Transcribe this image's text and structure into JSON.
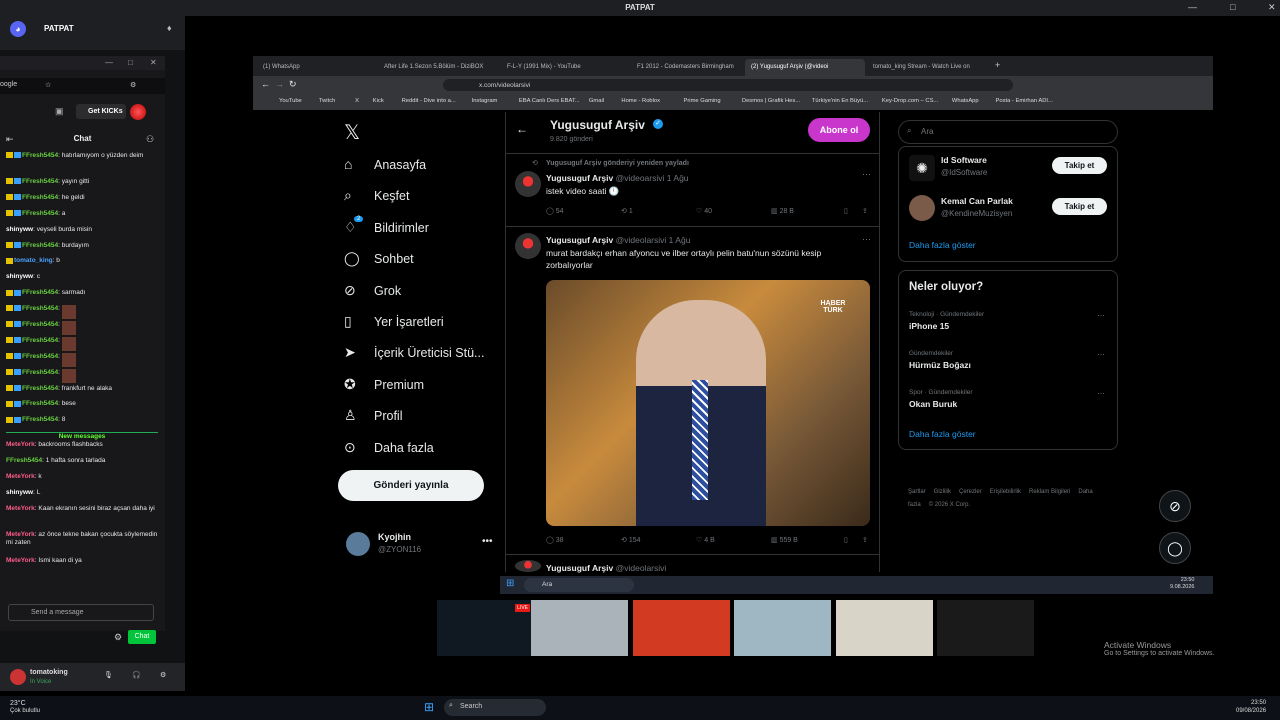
{
  "os": {
    "title": "PATPAT"
  },
  "discord": {
    "server": "PATPAT",
    "user": {
      "name": "tomatoking",
      "status": "In Voice"
    },
    "weather": {
      "temp": "23°C",
      "desc": "Çok bulutlu"
    }
  },
  "kick": {
    "search_label": "oogle",
    "get_kicks": "Get KICKs",
    "chat_title": "Chat",
    "input_placeholder": "Send a message",
    "send_label": "Chat",
    "new_messages": "New messages",
    "messages": [
      {
        "user": "FFresh5454",
        "text": "hatırlamıyom o yüzden deim",
        "color": "#69d13e",
        "badges": 2,
        "tall": true
      },
      {
        "user": "FFresh5454",
        "text": "yayın gitti",
        "color": "#69d13e",
        "badges": 2
      },
      {
        "user": "FFresh5454",
        "text": "he geldi",
        "color": "#69d13e",
        "badges": 2
      },
      {
        "user": "FFresh5454",
        "text": "a",
        "color": "#69d13e",
        "badges": 2
      },
      {
        "user": "shinyww",
        "text": "veyseli burda misin",
        "color": "#ffffff",
        "badges": 0
      },
      {
        "user": "FFresh5454",
        "text": "burdayım",
        "color": "#69d13e",
        "badges": 2
      },
      {
        "user": "tomato_king",
        "text": "b",
        "color": "#4aa3ff",
        "badges": 1
      },
      {
        "user": "shinyww",
        "text": "c",
        "color": "#ffffff",
        "badges": 0
      },
      {
        "user": "FFresh5454",
        "text": "sarmadı",
        "color": "#69d13e",
        "badges": 2
      },
      {
        "user": "FFresh5454",
        "text": "",
        "color": "#69d13e",
        "badges": 2
      },
      {
        "user": "FFresh5454",
        "text": "",
        "color": "#69d13e",
        "badges": 2
      },
      {
        "user": "FFresh5454",
        "text": "",
        "color": "#69d13e",
        "badges": 2
      },
      {
        "user": "FFresh5454",
        "text": "",
        "color": "#69d13e",
        "badges": 2
      },
      {
        "user": "FFresh5454",
        "text": "",
        "color": "#69d13e",
        "badges": 2
      },
      {
        "user": "FFresh5454",
        "text": "frankfurt ne alaka",
        "color": "#69d13e",
        "badges": 2
      },
      {
        "user": "FFresh5454",
        "text": "bese",
        "color": "#69d13e",
        "badges": 2
      },
      {
        "user": "FFresh5454",
        "text": "8",
        "color": "#69d13e",
        "badges": 2
      }
    ],
    "messages_after": [
      {
        "user": "MeteYork",
        "text": "backrooms flashbacks",
        "color": "#ff5c8a"
      },
      {
        "user": "FFresh5454",
        "text": "1 hafta sonra tarlada",
        "color": "#69d13e"
      },
      {
        "user": "MeteYork",
        "text": "k",
        "color": "#ff5c8a"
      },
      {
        "user": "shinyww",
        "text": "L",
        "color": "#ffffff"
      },
      {
        "user": "MeteYork",
        "text": "Kaan ekranın sesini biraz açsan daha iyi",
        "color": "#ff5c8a",
        "tall": true
      },
      {
        "user": "MeteYork",
        "text": "az önce tekne bakan çocukta söylemedin mi zaten",
        "color": "#ff5c8a",
        "tall": true
      },
      {
        "user": "MeteYork",
        "text": "İsmi kaan di ya",
        "color": "#ff5c8a"
      }
    ]
  },
  "browser": {
    "tabs": [
      {
        "label": "(1) WhatsApp",
        "active": false
      },
      {
        "label": "After Life 1.Sezon 5.Bölüm - DiziBOX",
        "active": false
      },
      {
        "label": "F-L-Y (1991 Mix) - YouTube",
        "active": false
      },
      {
        "label": "F1 2012 - Codemasters Birmingham",
        "active": false
      },
      {
        "label": "(2) Yugusuguf Arşiv (@videoi",
        "active": true
      },
      {
        "label": "tomato_king Stream - Watch Live on",
        "active": false
      }
    ],
    "url": "x.com/videolarsivi",
    "bookmarks": [
      "YouTube",
      "Twitch",
      "X",
      "Kick",
      "Reddit - Dive into a...",
      "Instagram",
      "EBA Canlı Ders EBAT...",
      "Gmail",
      "Home - Roblox",
      "Prime Gaming",
      "Desmos | Grafik Hes...",
      "Türkiye'nin En Büyü...",
      "Key-Drop.com – CS...",
      "WhatsApp",
      "Posta - Emirhan ADI..."
    ]
  },
  "x": {
    "nav": [
      {
        "label": "Anasayfa",
        "icon": "home-icon"
      },
      {
        "label": "Keşfet",
        "icon": "search-icon"
      },
      {
        "label": "Bildirimler",
        "icon": "bell-icon",
        "badge": "2"
      },
      {
        "label": "Sohbet",
        "icon": "chat-icon"
      },
      {
        "label": "Grok",
        "icon": "grok-icon"
      },
      {
        "label": "Yer İşaretleri",
        "icon": "bookmark-icon"
      },
      {
        "label": "İçerik Üreticisi Stü...",
        "icon": "creator-icon"
      },
      {
        "label": "Premium",
        "icon": "premium-icon"
      },
      {
        "label": "Profil",
        "icon": "profile-icon"
      },
      {
        "label": "Daha fazla",
        "icon": "more-icon"
      }
    ],
    "post_button": "Gönderi yayınla",
    "account": {
      "name": "Kyojhin",
      "handle": "@ZYON116"
    },
    "profile": {
      "name": "Yugusuguf Arşiv",
      "posts": "9.820 gönderi",
      "subscribe": "Abone ol"
    },
    "repost_note": "Yugusuguf Arşiv gönderiyi yeniden yayladı",
    "tweets": [
      {
        "name": "Yugusuguf Arşiv",
        "handle": "@videoarsivi",
        "date": "1 Ağu",
        "text": "istek video saati 🕛",
        "replies": "54",
        "reposts": "1",
        "likes": "40",
        "views": "28 B"
      },
      {
        "name": "Yugusuguf Arşiv",
        "handle": "@videolarsivi",
        "date": "1 Ağu",
        "text": "murat bardakçı erhan afyoncu ve ilber ortaylı pelin batu'nun sözünü kesip zorbalıyorlar",
        "replies": "38",
        "reposts": "154",
        "likes": "4 B",
        "views": "559 B"
      },
      {
        "name": "Yugusuguf Arşiv",
        "handle": "@videolarsivi"
      }
    ],
    "media_watermark": "HABER TÜRK",
    "search_placeholder": "Ara",
    "who_to_follow": [
      {
        "name": "Id Software",
        "handle": "@IdSoftware",
        "btn": "Takip et"
      },
      {
        "name": "Kemal Can Parlak",
        "handle": "@KendineMuzisyen",
        "btn": "Takip et"
      }
    ],
    "show_more": "Daha fazla göster",
    "trends_title": "Neler oluyor?",
    "trends": [
      {
        "context": "Teknoloji · Gündemdekiler",
        "topic": "iPhone 15"
      },
      {
        "context": "Gündemdekiler",
        "topic": "Hürmüz Boğazı"
      },
      {
        "context": "Spor · Gündemdekiler",
        "topic": "Okan Buruk"
      }
    ],
    "footer": [
      "Şartlar",
      "Gizlilik",
      "Çerezler",
      "Erişilebilirlik",
      "Reklam Bilgileri",
      "Daha fazla",
      "© 2026 X Corp."
    ]
  },
  "taskbar": {
    "search": "Ara",
    "time": "23:50",
    "date": "9.08.2026"
  },
  "host_taskbar": {
    "search": "Search",
    "time": "23:50",
    "date": "09/08/2026"
  },
  "live_badge": "LIVE",
  "activate": {
    "title": "Activate Windows",
    "sub": "Go to Settings to activate Windows."
  },
  "colors": {
    "accent_x": "#1d9bf0",
    "kick_green": "#53fc18",
    "subscribe": "#c936cc"
  }
}
